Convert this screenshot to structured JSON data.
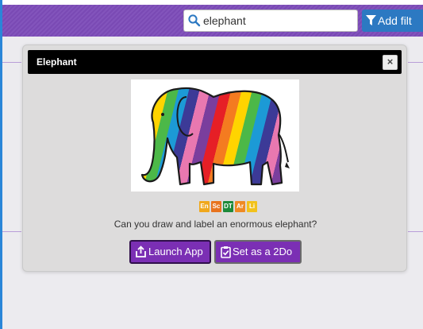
{
  "search": {
    "value": "elephant",
    "icon": "search-icon"
  },
  "filter": {
    "label": "Add filt",
    "icon": "filter-icon"
  },
  "modal": {
    "title": "Elephant",
    "close_label": "×",
    "subjects": [
      {
        "code": "En",
        "color": "#f0a81c"
      },
      {
        "code": "Sc",
        "color": "#e8731f"
      },
      {
        "code": "DT",
        "color": "#1d8a3a"
      },
      {
        "code": "Ar",
        "color": "#ef8a24"
      },
      {
        "code": "Li",
        "color": "#f2c21c"
      }
    ],
    "question": "Can you draw and label an enormous elephant?",
    "launch_label": "Launch App",
    "todo_label": "Set as a 2Do"
  },
  "colors": {
    "topbar": "#7c4bb8",
    "accent": "#7b2fb4",
    "filter": "#2c79c2"
  }
}
